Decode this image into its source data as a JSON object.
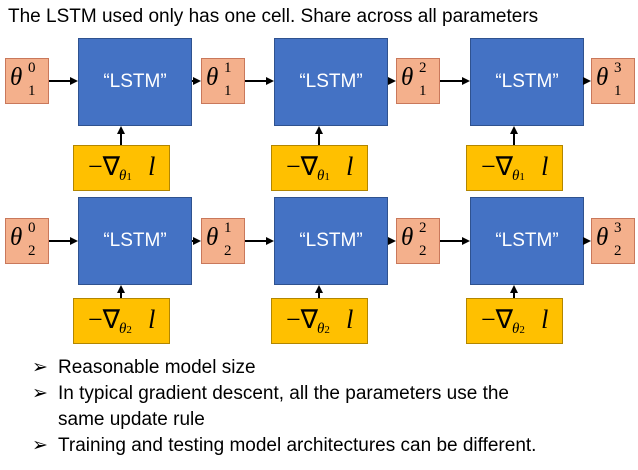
{
  "title": "The LSTM used only has one cell. Share across all parameters",
  "lstm_label": "“LSTM”",
  "rows": [
    {
      "param_index": "1",
      "thetas": [
        {
          "symbol": "θ",
          "sup": "0",
          "sub": "1"
        },
        {
          "symbol": "θ",
          "sup": "1",
          "sub": "1"
        },
        {
          "symbol": "θ",
          "sup": "2",
          "sub": "1"
        },
        {
          "symbol": "θ",
          "sup": "3",
          "sub": "1"
        }
      ],
      "gradient": {
        "prefix": "−∇",
        "sub_symbol": "θ",
        "sub_index": "1",
        "suffix": "l"
      }
    },
    {
      "param_index": "2",
      "thetas": [
        {
          "symbol": "θ",
          "sup": "0",
          "sub": "2"
        },
        {
          "symbol": "θ",
          "sup": "1",
          "sub": "2"
        },
        {
          "symbol": "θ",
          "sup": "2",
          "sub": "2"
        },
        {
          "symbol": "θ",
          "sup": "3",
          "sub": "2"
        }
      ],
      "gradient": {
        "prefix": "−∇",
        "sub_symbol": "θ",
        "sub_index": "2",
        "suffix": "l"
      }
    }
  ],
  "bullets": [
    {
      "mark": "➢",
      "lines": [
        "Reasonable model size"
      ]
    },
    {
      "mark": "➢",
      "lines": [
        "In typical gradient descent, all the parameters use the",
        "same update rule"
      ]
    },
    {
      "mark": "➢",
      "lines": [
        "Training and testing model architectures can be different."
      ]
    }
  ],
  "colors": {
    "theta_fill": "#f4b08c",
    "lstm_fill": "#4472c4",
    "gradient_fill": "#ffc000",
    "arrow": "#000000"
  }
}
